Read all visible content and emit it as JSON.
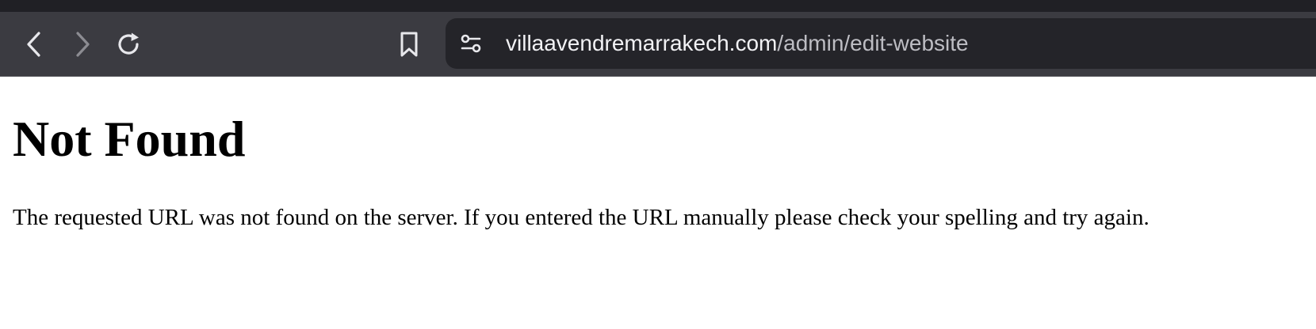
{
  "browser": {
    "nav": {
      "back_icon": "chevron-left-icon",
      "forward_icon": "chevron-right-icon",
      "reload_icon": "reload-icon",
      "bookmark_icon": "bookmark-icon",
      "site_settings_icon": "sliders-icon"
    },
    "address_bar": {
      "host": "villaavendremarrakech.com",
      "path": "/admin/edit-website"
    },
    "colors": {
      "toolbar": "#3b3b41",
      "urlbar": "#242429",
      "top_strip": "#202025"
    }
  },
  "page": {
    "title": "Not Found",
    "message": "The requested URL was not found on the server. If you entered the URL manually please check your spelling and try again."
  }
}
